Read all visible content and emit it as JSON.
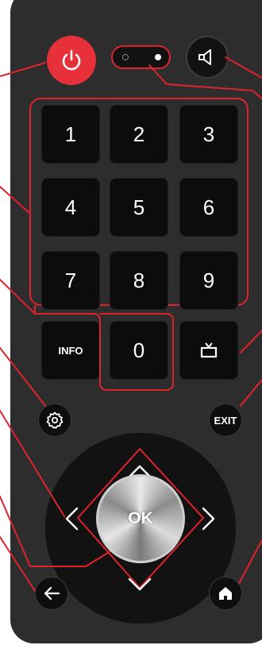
{
  "numpad": {
    "keys": [
      "1",
      "2",
      "3",
      "4",
      "5",
      "6",
      "7",
      "8",
      "9"
    ],
    "zero": "0"
  },
  "buttons": {
    "info": "INFO",
    "exit": "EXIT",
    "ok": "OK"
  },
  "colors": {
    "accent": "#e0222c",
    "power": "#e8303a",
    "remote_body": "#2d2d2d",
    "key_face": "#0c0c0c"
  },
  "icons": {
    "power": "power-icon",
    "mute": "speaker-mute-icon",
    "tv": "tv-icon",
    "settings": "gear-icon",
    "back": "arrow-left-icon",
    "home": "home-icon",
    "up": "chevron-up-icon",
    "down": "chevron-down-icon",
    "left": "chevron-left-icon",
    "right": "chevron-right-icon"
  }
}
